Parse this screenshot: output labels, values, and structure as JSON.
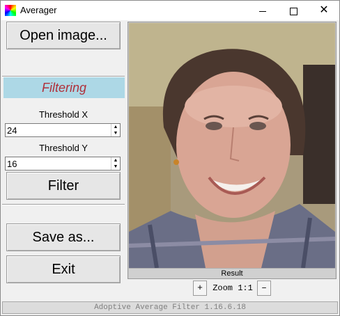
{
  "window": {
    "title": "Averager",
    "minimize_glyph": "",
    "close_glyph": "✕"
  },
  "buttons": {
    "open": "Open image...",
    "filter": "Filter",
    "save": "Save as...",
    "exit": "Exit"
  },
  "filtering": {
    "header": "Filtering",
    "threshold_x_label": "Threshold X",
    "threshold_x_value": "24",
    "threshold_y_label": "Threshold Y",
    "threshold_y_value": "16"
  },
  "image": {
    "caption": "Result"
  },
  "zoom": {
    "plus": "+",
    "label": "Zoom 1:1",
    "minus": "–"
  },
  "status": {
    "text": "Adoptive Average Filter 1.16.6.18"
  },
  "colors": {
    "section_bg": "#add8e6",
    "section_text": "#b0303a"
  },
  "icons": [
    "app-icon",
    "minimize-icon",
    "maximize-icon",
    "close-icon",
    "spin-up-icon",
    "spin-down-icon"
  ]
}
